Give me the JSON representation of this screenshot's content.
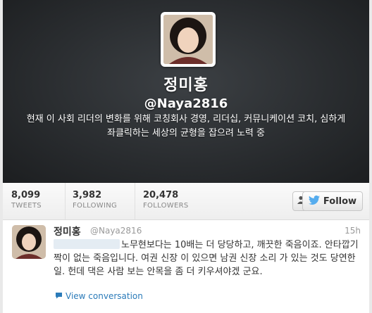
{
  "profile": {
    "full_name": "정미홍",
    "screen_name": "@Naya2816",
    "bio": "현재 이 사회 리더의 변화를 위해 코칭회사 경영, 리더십, 커뮤니케이션 코치, 심하게 좌클릭하는 세상의 균형을 잡으려 노력 중"
  },
  "stats": [
    {
      "value": "8,099",
      "label": "TWEETS"
    },
    {
      "value": "3,982",
      "label": "FOLLOWING"
    },
    {
      "value": "20,478",
      "label": "FOLLOWERS"
    }
  ],
  "actions": {
    "follow_label": "Follow"
  },
  "tweet": {
    "name": "정미홍",
    "handle": "@Naya2816",
    "time": "15h",
    "text": "노무현보다는 10배는 더 당당하고, 깨끗한 죽음이죠. 안타깝기 짝이 없는 죽음입니다. 여권 신장 이 있으면 남권 신장 소리 가 있는 것도 당연한 일. 헌데 댁은 사람 보는 안목을 좀 더 키우셔야겠 군요.",
    "view_conversation": "View conversation"
  },
  "colors": {
    "link": "#2b7bb9",
    "header_bg": "#2a2d30",
    "twitter_bird": "#55acee"
  }
}
